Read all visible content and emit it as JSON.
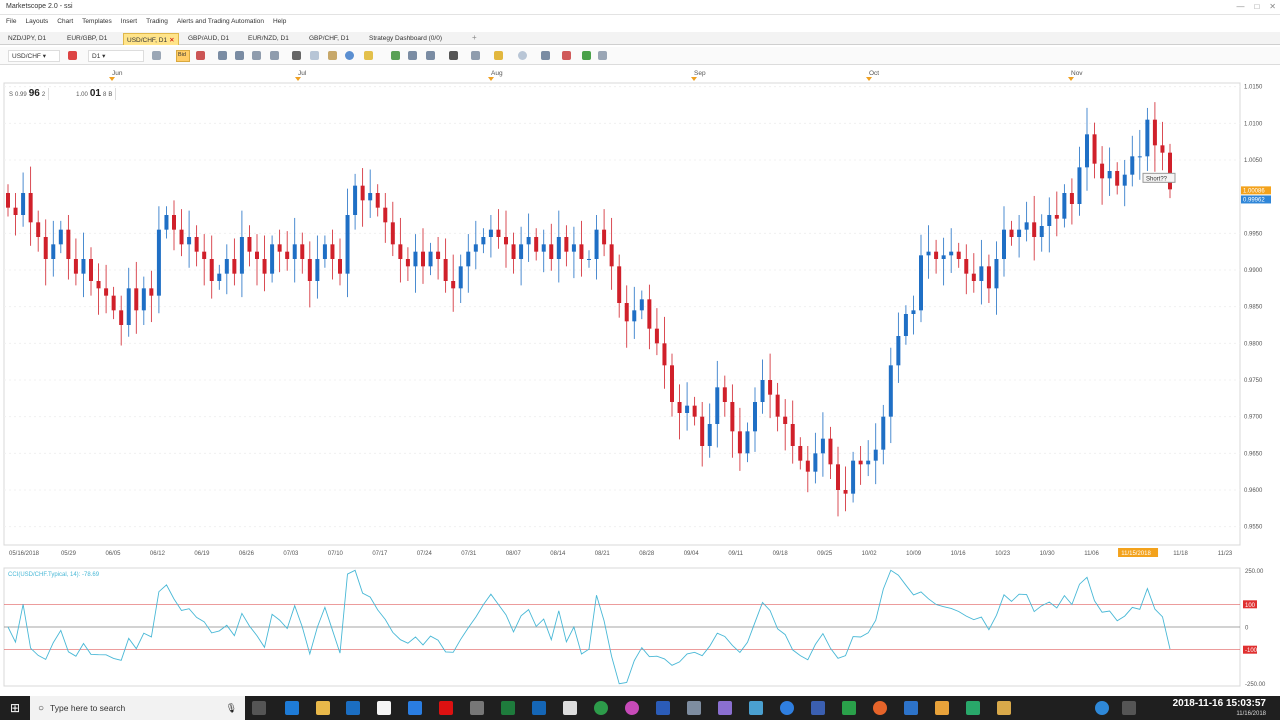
{
  "window": {
    "title": "Marketscope 2.0 - ssi"
  },
  "menu": [
    "File",
    "Layouts",
    "Chart",
    "Templates",
    "Insert",
    "Trading",
    "Alerts and Trading Automation",
    "Help"
  ],
  "tabs": [
    {
      "label": "NZD/JPY, D1",
      "active": false
    },
    {
      "label": "EUR/GBP, D1",
      "active": false
    },
    {
      "label": "USD/CHF, D1",
      "active": true
    },
    {
      "label": "GBP/AUD, D1",
      "active": false
    },
    {
      "label": "EUR/NZD, D1",
      "active": false
    },
    {
      "label": "GBP/CHF, D1",
      "active": false
    },
    {
      "label": "Strategy Dashboard (0/0)",
      "active": false
    }
  ],
  "toolbar": {
    "symbol": "USD/CHF",
    "timeframe": "D1",
    "bid_label": "Bid"
  },
  "quote": {
    "sell_label": "S",
    "sell_prefix": "0.99",
    "sell_big": "96",
    "sell_sup": "2",
    "buy_prefix": "1.00",
    "buy_big": "01",
    "buy_sup": "8",
    "buy_label": "B"
  },
  "chart_data": [
    {
      "type": "candlestick",
      "symbol": "USD/CHF",
      "timeframe": "D1",
      "month_labels": [
        "Jun",
        "Jul",
        "Aug",
        "Sep",
        "Oct",
        "Nov"
      ],
      "x_labels": [
        "05/16/2018",
        "05/29",
        "06/05",
        "06/12",
        "06/19",
        "06/26",
        "07/03",
        "07/10",
        "07/17",
        "07/24",
        "07/31",
        "08/07",
        "08/14",
        "08/21",
        "08/28",
        "09/04",
        "09/11",
        "09/18",
        "09/25",
        "10/02",
        "10/09",
        "10/16",
        "10/23",
        "10/30",
        "11/06",
        "11/15/2018",
        "11/18",
        "11/23"
      ],
      "y_ticks": [
        "1.0150",
        "1.0100",
        "1.0050",
        "0.9950",
        "0.9900",
        "0.9850",
        "0.9800",
        "0.9750",
        "0.9700",
        "0.9650",
        "0.9600",
        "0.9550"
      ],
      "ylim": [
        0.9525,
        1.0155
      ],
      "current_price": "1.00086",
      "bid_price": "0.99962",
      "annotation": "Short??",
      "closes": [
        0.9985,
        0.9975,
        1.0005,
        0.9965,
        0.9945,
        0.9915,
        0.9935,
        0.9955,
        0.9915,
        0.9895,
        0.9915,
        0.9885,
        0.9875,
        0.9865,
        0.9845,
        0.9825,
        0.9875,
        0.9845,
        0.9875,
        0.9865,
        0.9955,
        0.9975,
        0.9955,
        0.9935,
        0.9945,
        0.9925,
        0.9915,
        0.9885,
        0.9895,
        0.9915,
        0.9895,
        0.9945,
        0.9925,
        0.9915,
        0.9895,
        0.9935,
        0.9925,
        0.9915,
        0.9935,
        0.9915,
        0.9885,
        0.9915,
        0.9935,
        0.9915,
        0.9895,
        0.9975,
        1.0015,
        0.9995,
        1.0005,
        0.9985,
        0.9965,
        0.9935,
        0.9915,
        0.9905,
        0.9925,
        0.9905,
        0.9925,
        0.9915,
        0.9885,
        0.9875,
        0.9905,
        0.9925,
        0.9935,
        0.9945,
        0.9955,
        0.9945,
        0.9935,
        0.9915,
        0.9935,
        0.9945,
        0.9925,
        0.9935,
        0.9915,
        0.9945,
        0.9925,
        0.9935,
        0.9915,
        0.9915,
        0.9955,
        0.9935,
        0.9905,
        0.9855,
        0.983,
        0.9845,
        0.986,
        0.982,
        0.98,
        0.977,
        0.972,
        0.9705,
        0.9715,
        0.97,
        0.966,
        0.969,
        0.974,
        0.972,
        0.968,
        0.965,
        0.968,
        0.972,
        0.975,
        0.973,
        0.97,
        0.969,
        0.966,
        0.964,
        0.9625,
        0.965,
        0.967,
        0.9635,
        0.96,
        0.9595,
        0.964,
        0.9635,
        0.964,
        0.9655,
        0.97,
        0.977,
        0.981,
        0.984,
        0.9845,
        0.992,
        0.9925,
        0.9915,
        0.992,
        0.9925,
        0.9915,
        0.9895,
        0.9885,
        0.9905,
        0.9875,
        0.9915,
        0.9955,
        0.9945,
        0.9955,
        0.9965,
        0.9945,
        0.996,
        0.9975,
        0.997,
        1.0005,
        0.999,
        1.004,
        1.0085,
        1.0045,
        1.0025,
        1.0035,
        1.0015,
        1.003,
        1.0055,
        1.0055,
        1.0105,
        1.007,
        1.006,
        1.001
      ]
    },
    {
      "type": "line",
      "label": "CCI(USD/CHF.Typical, 14): -78.69",
      "y_ticks": [
        "250.00",
        "100",
        "0",
        "-100",
        "-250.00"
      ],
      "ylim": [
        -260,
        260
      ],
      "levels": [
        100,
        0,
        -100
      ]
    }
  ],
  "taskbar": {
    "search_placeholder": "Type here to search",
    "time": "2018-11-16 15:03:57",
    "date": "11/16/2018"
  },
  "colors": {
    "up": "#1f6fc5",
    "down": "#d0202a",
    "cci": "#49b8d6",
    "tab_active": "#ffe48a"
  }
}
